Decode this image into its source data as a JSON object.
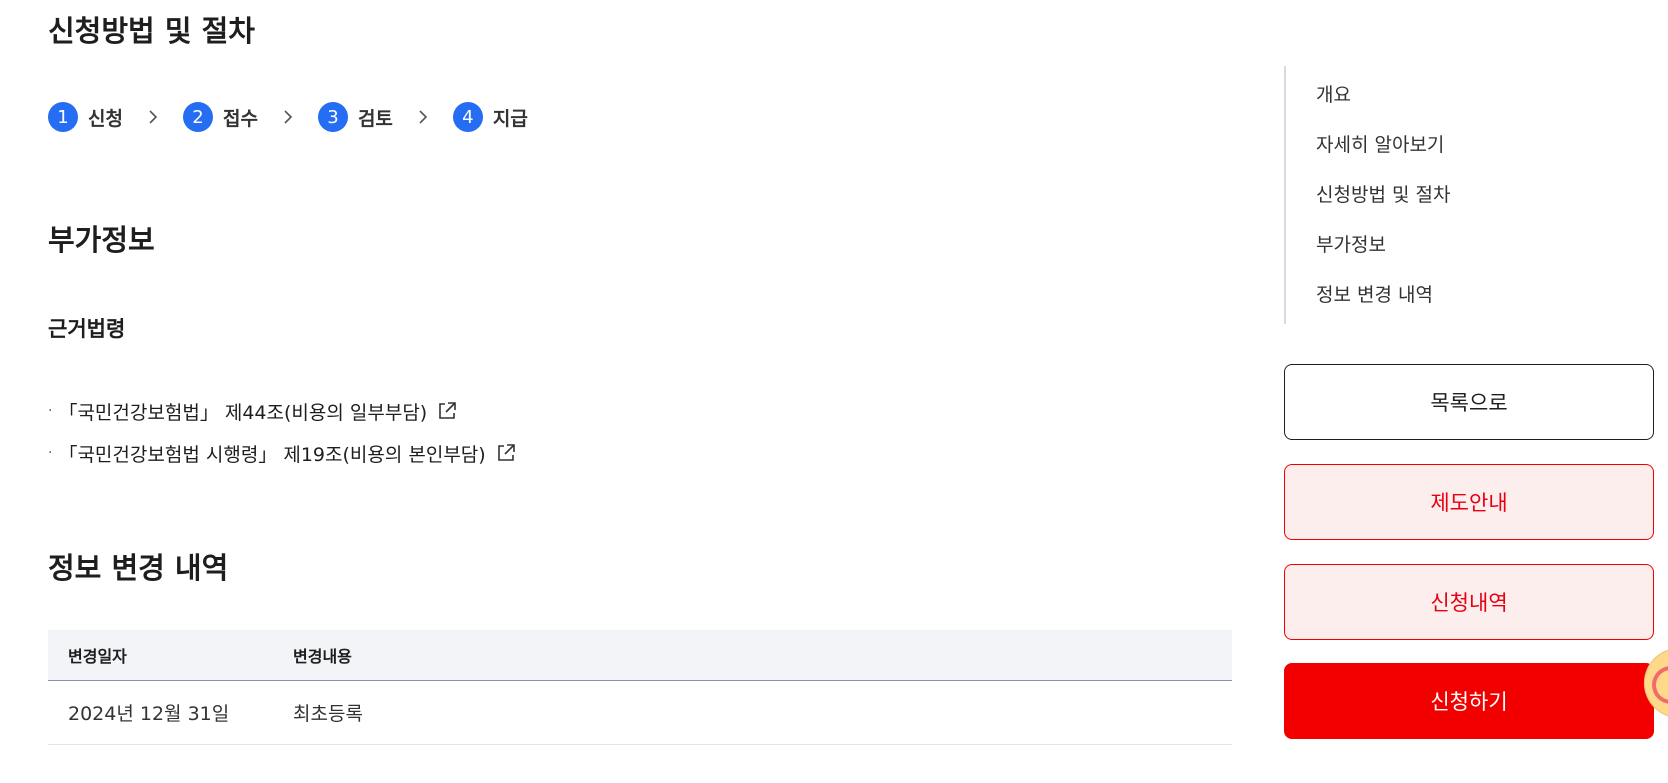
{
  "main": {
    "procedure_title": "신청방법 및 절차",
    "steps": [
      {
        "num": "1",
        "label": "신청"
      },
      {
        "num": "2",
        "label": "접수"
      },
      {
        "num": "3",
        "label": "검토"
      },
      {
        "num": "4",
        "label": "지급"
      }
    ],
    "additional_title": "부가정보",
    "legal_basis_title": "근거법령",
    "laws": [
      "「국민건강보험법」 제44조(비용의 일부부담)",
      "「국민건강보험법 시행령」 제19조(비용의 본인부담)"
    ],
    "change_history_title": "정보 변경 내역",
    "table": {
      "headers": [
        "변경일자",
        "변경내용"
      ],
      "rows": [
        [
          "2024년 12월 31일",
          "최초등록"
        ]
      ]
    }
  },
  "sidebar": {
    "toc": [
      "개요",
      "자세히 알아보기",
      "신청방법 및 절차",
      "부가정보",
      "정보 변경 내역"
    ],
    "buttons": {
      "list": "목록으로",
      "guide": "제도안내",
      "history": "신청내역",
      "apply": "신청하기"
    },
    "colors": {
      "accent_red": "#f20000",
      "step_blue": "#256ef4"
    }
  }
}
